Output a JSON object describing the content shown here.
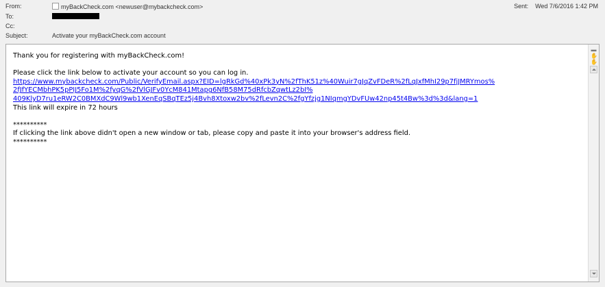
{
  "header": {
    "from_label": "From:",
    "from_value": "myBackCheck.com <newuser@mybackcheck.com>",
    "to_label": "To:",
    "cc_label": "Cc:",
    "subject_label": "Subject:",
    "subject_value": "Activate your myBackCheck.com account",
    "sent_label": "Sent:",
    "sent_value": "Wed 7/6/2016 1:42 PM"
  },
  "message": {
    "greeting": "Thank you for registering with myBackCheck.com!",
    "instruction": "Please click the link below to activate your account so you can log in.",
    "link_line1": "https://www.mybackcheck.com/Public/VerifyEmail.aspx?EID=lgRkGd%40xPk3yN%2fThK51z%40Wuir7gJqZvFDeR%2fLqJxfMhI29p7fjJMRYmos%",
    "link_line2": "2fJfYECMbhPK5pPIJ5Fo1M%2fyqG%2fVlGJFv0YcM841Mtapg6NfB58M75dRfcbZqwtLz2bI%",
    "link_line3": "409KlyD7ru1eRW2C0BMXdC9Wl9wb1XenEqSBqTEz5j4Bvh8Xtoxw2bv%2fLevn2C%2fgYfzjg1NIqmgYDvFUw42np45t4Bw%3d%3d&lang=1",
    "expiry": "This link will expire in 72 hours",
    "separator_top": "**********",
    "fallback": "If clicking the link above didn't open a new window or tab, please copy and paste it into your browser's address field.",
    "separator_bottom": "**********"
  },
  "icons": {
    "checkbox": "checkbox-icon",
    "collapse": "collapse-icon",
    "pan": "pan-hand-icon",
    "scroll_up": "scroll-up-icon",
    "scroll_down": "scroll-down-icon"
  },
  "colors": {
    "link": "#0000ee",
    "background": "#f0f0f0",
    "body_bg": "#ffffff"
  }
}
